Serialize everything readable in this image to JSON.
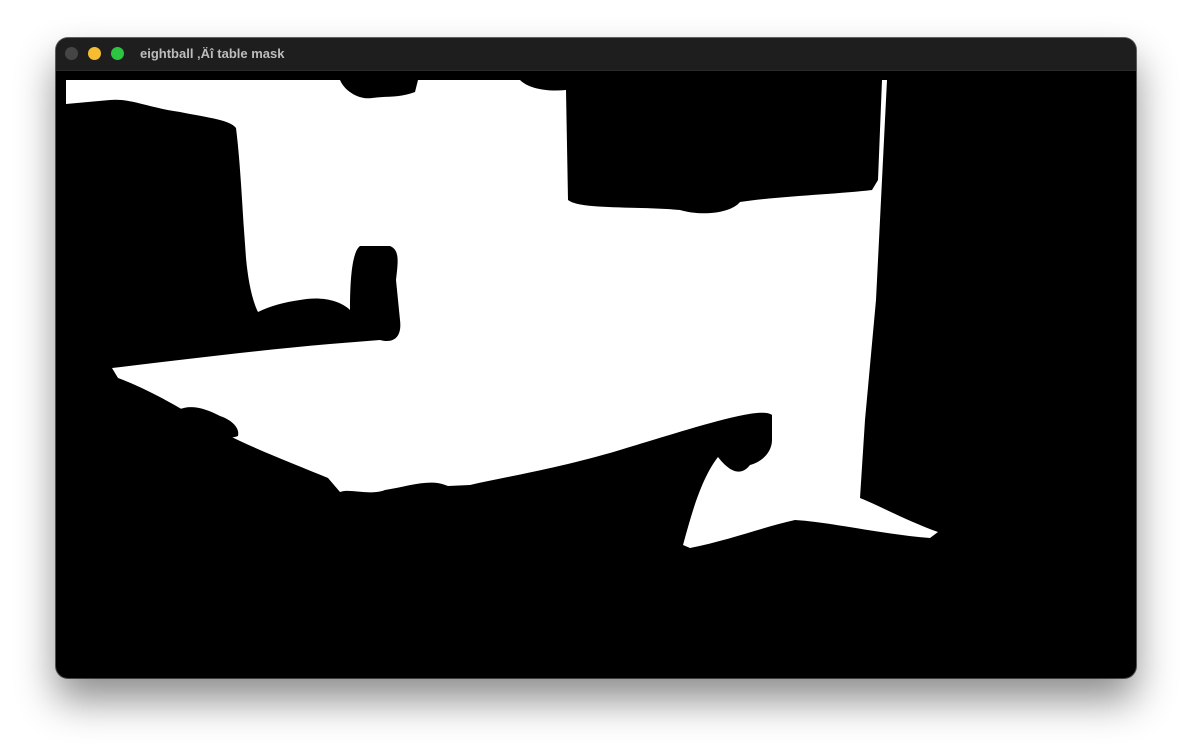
{
  "window": {
    "title": "eightball ‚Äî table mask"
  },
  "icons": {
    "close": "close-button",
    "minimize": "minimize-button",
    "maximize": "maximize-button"
  },
  "colors": {
    "mask_foreground": "#ffffff",
    "mask_background": "#000000",
    "titlebar": "#1e1e1e",
    "close": "#454545",
    "minimize": "#f5bd2f",
    "maximize": "#2dc441"
  }
}
